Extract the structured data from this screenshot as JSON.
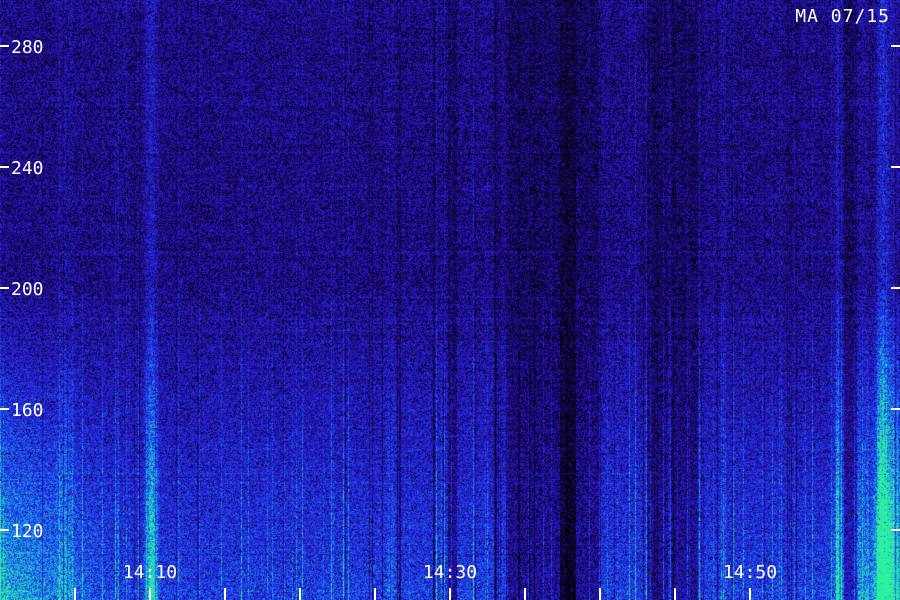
{
  "station_label": "MA 07/15",
  "chart_data": {
    "type": "heatmap",
    "title": "",
    "xlabel": "",
    "ylabel": "",
    "x_unit": "time",
    "x_range": [
      "14:03",
      "14:51"
    ],
    "x_labeled_ticks": [
      {
        "label": "14:10",
        "minutes": 10
      },
      {
        "label": "14:30",
        "minutes": 30
      },
      {
        "label": "14:50",
        "minutes": 50
      }
    ],
    "x_minor_ticks_minutes": [
      5,
      10,
      15,
      20,
      25,
      30,
      35,
      40,
      45,
      50
    ],
    "ylim": [
      108,
      292
    ],
    "y_ticks": [
      120,
      160,
      200,
      240,
      280
    ],
    "colormap": [
      "#000000",
      "#1a0a6e",
      "#2a14c8",
      "#1846f0",
      "#1e9be6",
      "#2cf0a0"
    ],
    "intensity_profile": "strongest at low values (below 200) and at the start and end of the time span; weak, dark purple above 200",
    "grid": false,
    "legend": "none"
  }
}
